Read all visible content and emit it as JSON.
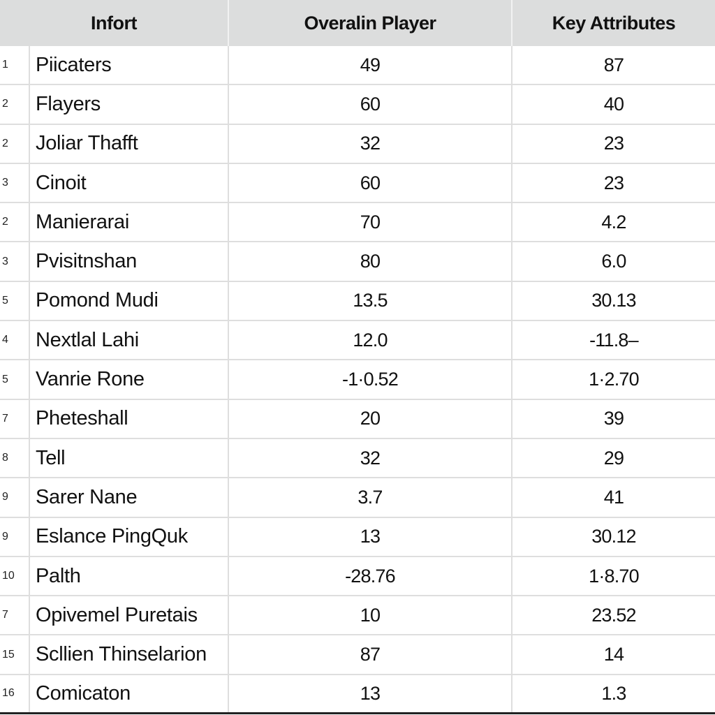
{
  "table": {
    "headers": [
      "Infort",
      "Overalin Player",
      "Key Attributes"
    ],
    "rows": [
      {
        "idx": "1",
        "name": "Piicaters",
        "overall": "49",
        "key": "87"
      },
      {
        "idx": "2",
        "name": "Flayers",
        "overall": "60",
        "key": "40"
      },
      {
        "idx": "2",
        "name": "Joliar Thafft",
        "overall": "32",
        "key": "23"
      },
      {
        "idx": "3",
        "name": "Cinoit",
        "overall": "60",
        "key": "23"
      },
      {
        "idx": "2",
        "name": "Manierarai",
        "overall": "70",
        "key": "4.2"
      },
      {
        "idx": "3",
        "name": "Pvisitnshan",
        "overall": "80",
        "key": "6.0"
      },
      {
        "idx": "5",
        "name": "Pomond Mudi",
        "overall": "13.5",
        "key": "30.13"
      },
      {
        "idx": "4",
        "name": "Nextlal Lahi",
        "overall": "12.0",
        "key": "-11.8–"
      },
      {
        "idx": "5",
        "name": "Vanrie Rone",
        "overall": "-1·0.52",
        "key": "1·2.70"
      },
      {
        "idx": "7",
        "name": "Pheteshall",
        "overall": "20",
        "key": "39"
      },
      {
        "idx": "8",
        "name": "Tell",
        "overall": "32",
        "key": "29"
      },
      {
        "idx": "9",
        "name": "Sarer Nane",
        "overall": "3.7",
        "key": "41"
      },
      {
        "idx": "9",
        "name": "Eslance PingQuk",
        "overall": "13",
        "key": "30.12"
      },
      {
        "idx": "10",
        "name": "Palth",
        "overall": "-28.76",
        "key": "1·8.70"
      },
      {
        "idx": "7",
        "name": "Opivemel Puretais",
        "overall": "10",
        "key": "23.52"
      },
      {
        "idx": "15",
        "name": "Scllien Thinselarion",
        "overall": "87",
        "key": "14"
      },
      {
        "idx": "16",
        "name": "Comicaton",
        "overall": "13",
        "key": "1.3"
      }
    ]
  }
}
